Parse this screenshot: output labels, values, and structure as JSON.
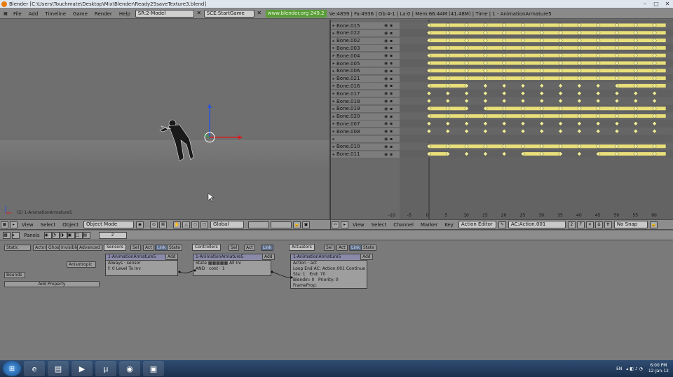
{
  "window": {
    "title": "Blender [C:\\Users\\Touchmate\\Desktop\\Mix\\Blender\\Ready25saveTexture3.blend]",
    "controls": [
      "–",
      "□",
      "✕"
    ]
  },
  "menubar": {
    "items": [
      "File",
      "Add",
      "Timeline",
      "Game",
      "Render",
      "Help"
    ],
    "screen": "SR:2-Model",
    "scene": "SCE:StartGame",
    "url": "www.blender.org 249.2",
    "stats": "Ve:4859 | Fa:4936 | Ob:4-1 | La:0 | Mem:66.44M (41.48M) | Time | 1 - AnimationArmature5"
  },
  "viewport": {
    "label": "(2) 1-AnimationArmature5"
  },
  "viewport_header": {
    "items": [
      "View",
      "Select",
      "Object"
    ],
    "mode": "Object Mode",
    "orientation": "Global"
  },
  "action_editor": {
    "channels": [
      "Bone.015",
      "Bone.022",
      "Bone.002",
      "Bone.003",
      "Bone.004",
      "Bone.005",
      "Bone.006",
      "Bone.021",
      "Bone.016",
      "Bone.017",
      "Bone.018",
      "Bone.019",
      "Bone.020",
      "Bone.007",
      "Bone.008",
      "",
      "Bone.010",
      "Bone.011"
    ],
    "ruler": [
      "-10",
      "-5",
      "0",
      "5",
      "10",
      "15",
      "20",
      "25",
      "30",
      "35",
      "40",
      "45",
      "50",
      "55",
      "60"
    ],
    "header_items": [
      "View",
      "Select",
      "Channel",
      "Marker",
      "Key"
    ],
    "editor_type": "Action Editor",
    "action_name": "AC:Action.001",
    "users": "2",
    "snap": "No Snap"
  },
  "logic": {
    "header_panels": "Panels",
    "header_value": "2",
    "static_btn": "Static",
    "actor_btn": "Actor",
    "ghost_btn": "Ghost",
    "invisible_btn": "Invisible",
    "advanced_btn": "Advanced",
    "anisotropic_btn": "Anisotropic",
    "bounds_btn": "Bounds",
    "add_property_btn": "Add Property",
    "sensors_label": "Sensors",
    "controllers_label": "Controllers",
    "actuators_label": "Actuators",
    "sel_label": "Sel",
    "act_label": "Act",
    "link_label": "Link",
    "state_label": "State",
    "add_label": "Add",
    "object_name": "1-AnimationArmature5",
    "sensor": {
      "type": "Always",
      "name": "sensor",
      "f": "f: 0",
      "level": "Level",
      "tap": "Ta",
      "inv": "Inv"
    },
    "controller": {
      "state": "State",
      "all": "All",
      "ini": "Ini",
      "type": "AND",
      "name": "cont",
      "num": "1"
    },
    "actuator": {
      "type": "Action",
      "name": "act",
      "play": "Loop End",
      "action": "AC: Action.001",
      "continue": "Continue",
      "sta": "Sta: 1",
      "end": "End: 70",
      "blendin": "Blendin: 0",
      "priority": "Priority: 0",
      "frameprop": "FrameProp:"
    }
  },
  "taskbar": {
    "lang": "EN",
    "time": "6:00 PM",
    "date": "12-Jan-12"
  },
  "colors": {
    "keyframe_bar": "#e9e07a",
    "keyframe_dot": "#f2ed9a",
    "x_axis": "#d22020",
    "y_axis": "#22a83a",
    "z_axis": "#2f54d6"
  }
}
